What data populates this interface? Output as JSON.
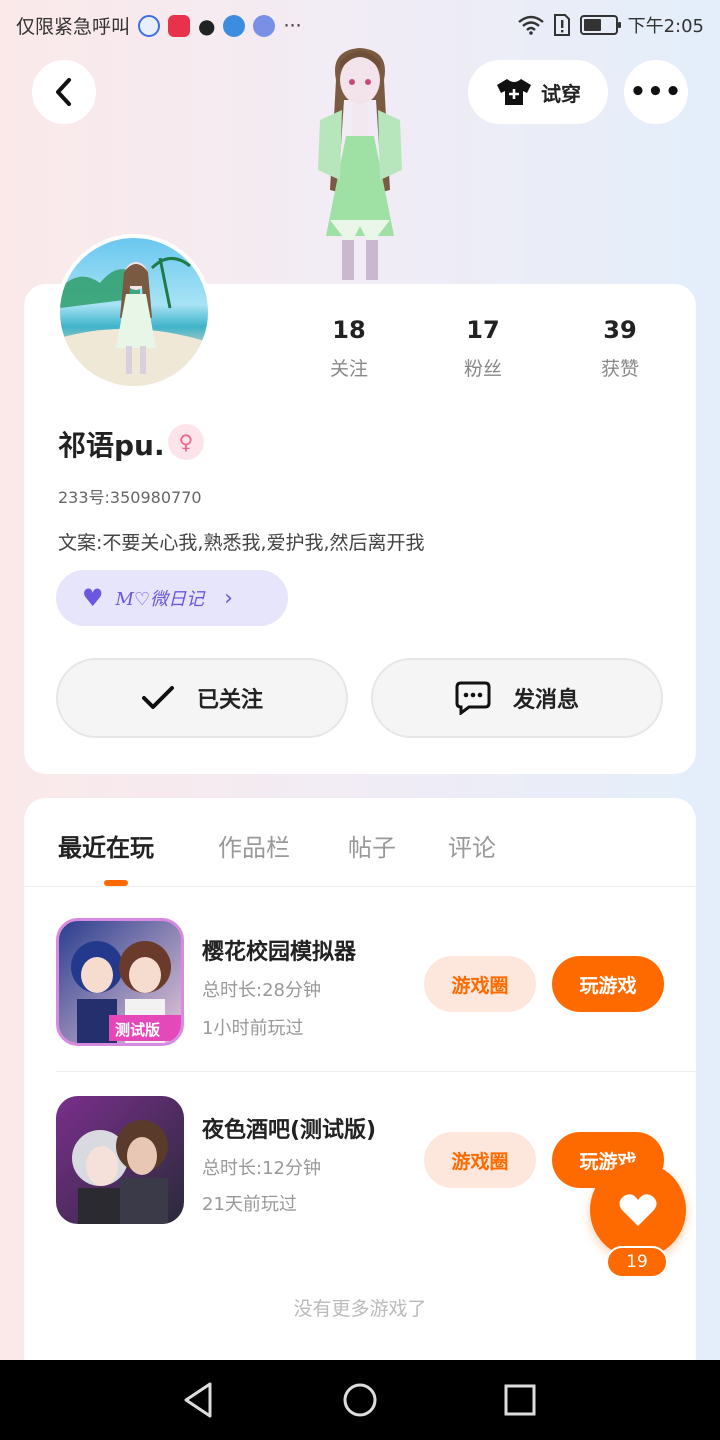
{
  "status_bar": {
    "carrier_text": "仅限紧急呼叫",
    "dots": "···",
    "time": "下午2:05",
    "battery_level": 0.55
  },
  "header": {
    "tryon_label": "试穿",
    "more_label": "•••"
  },
  "profile": {
    "stats": [
      {
        "value": "18",
        "label": "关注"
      },
      {
        "value": "17",
        "label": "粉丝"
      },
      {
        "value": "39",
        "label": "获赞"
      }
    ],
    "nickname": "祁语pu.",
    "gender_symbol": "♀",
    "uid": "233号:350980770",
    "bio": "文案:不要关心我,熟悉我,爱护我,然后离开我",
    "medal_text": "M♡微日记",
    "follow_label": "已关注",
    "message_label": "发消息"
  },
  "tabs": [
    {
      "label": "最近在玩",
      "active": true
    },
    {
      "label": "作品栏",
      "active": false
    },
    {
      "label": "帖子",
      "active": false
    },
    {
      "label": "评论",
      "active": false
    }
  ],
  "games": [
    {
      "title": "樱花校园模拟器",
      "duration": "总时长:28分钟",
      "last_played": "1小时前玩过",
      "circle_label": "游戏圈",
      "play_label": "玩游戏",
      "badge": "测试版"
    },
    {
      "title": "夜色酒吧(测试版)",
      "duration": "总时长:12分钟",
      "last_played": "21天前玩过",
      "circle_label": "游戏圈",
      "play_label": "玩游戏"
    }
  ],
  "no_more_text": "没有更多游戏了",
  "like": {
    "count": "19"
  },
  "colors": {
    "accent": "#ff6a00",
    "medal": "#6b57e0",
    "gender": "#f0648a"
  }
}
